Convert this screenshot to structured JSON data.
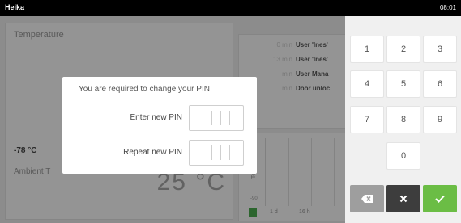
{
  "status_bar": {
    "user": "Heika",
    "time": "08:01"
  },
  "dashboard": {
    "temperature_card": {
      "title": "Temperature",
      "setpoint": "-78 °C",
      "ambient_label": "Ambient T",
      "big_value": "25 °C"
    },
    "event_log": [
      {
        "time": "0 min",
        "message": "User 'Ines'"
      },
      {
        "time": "13 min",
        "message": "User 'Ines'"
      },
      {
        "time": "min",
        "message": "User Mana"
      },
      {
        "time": "min",
        "message": "Door unloc"
      }
    ],
    "chart": {
      "y_label": "Temp",
      "y_tick": "-90",
      "x_ticks": [
        "1 d",
        "16 h"
      ]
    }
  },
  "pin_dialog": {
    "heading": "You are required to change your PIN",
    "new_pin_label": "Enter new PIN",
    "repeat_pin_label": "Repeat new PIN"
  },
  "keypad": {
    "keys": [
      "1",
      "2",
      "3",
      "4",
      "5",
      "6",
      "7",
      "8",
      "9",
      "0"
    ],
    "action_colors": {
      "backspace": "#9e9e9e",
      "clear": "#3d3d3d",
      "confirm": "#6bbd45"
    },
    "action_icons": [
      "backspace-icon",
      "close-icon",
      "checkmark-icon"
    ]
  }
}
